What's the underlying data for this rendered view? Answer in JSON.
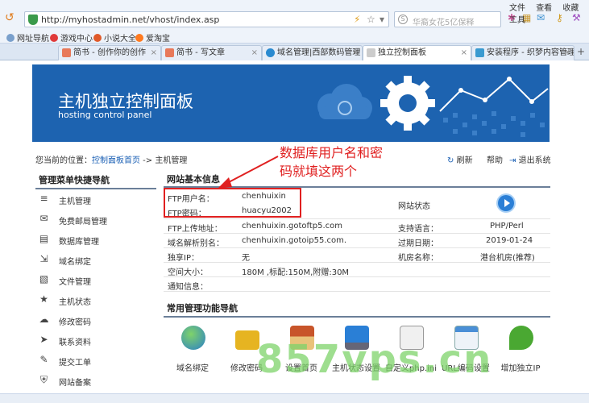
{
  "browser": {
    "url": "http://myhostadmin.net/vhost/index.asp",
    "search_placeholder": "华裔女花5亿保释",
    "menu": [
      "文件",
      "查看",
      "收藏",
      "工具"
    ],
    "bookmarks": [
      "网址导航",
      "游戏中心",
      "小说大全",
      "爱淘宝"
    ],
    "tabs": [
      {
        "label": "简书 - 创作你的创作",
        "active": false
      },
      {
        "label": "简书 - 写文章",
        "active": false
      },
      {
        "label": "域名管理|西部数码管理",
        "active": false
      },
      {
        "label": "独立控制面板",
        "active": true
      },
      {
        "label": "安装程序 - 织梦内容管理",
        "active": false
      }
    ],
    "new_tab": "+"
  },
  "banner": {
    "title": "主机独立控制面板",
    "subtitle": "hosting control panel"
  },
  "breadcrumb": {
    "prefix": "您当前的位置：",
    "home": "控制面板首页",
    "sep": " -> ",
    "current": "主机管理"
  },
  "actions": {
    "refresh": "刷新",
    "help": "帮助",
    "logout": "退出系统"
  },
  "sidebar": {
    "title": "管理菜单快捷导航",
    "items": [
      {
        "label": "主机管理",
        "icon": "database-icon"
      },
      {
        "label": "免费邮局管理",
        "icon": "mail-icon"
      },
      {
        "label": "数据库管理",
        "icon": "db-icon"
      },
      {
        "label": "域名绑定",
        "icon": "bind-icon"
      },
      {
        "label": "文件管理",
        "icon": "file-icon"
      },
      {
        "label": "主机状态",
        "icon": "star-icon"
      },
      {
        "label": "修改密码",
        "icon": "cloud-icon"
      },
      {
        "label": "联系资料",
        "icon": "send-icon"
      },
      {
        "label": "提交工单",
        "icon": "pencil-icon"
      },
      {
        "label": "网站备案",
        "icon": "shield-icon"
      }
    ]
  },
  "info": {
    "title": "网站基本信息",
    "ftp_user_label": "FTP用户名：",
    "ftp_user": "chenhuixin",
    "ftp_pass_label": "FTP密码：",
    "ftp_pass": "huacyu2002",
    "site_status_label": "网站状态",
    "ftp_addr_label": "FTP上传地址：",
    "ftp_addr": "chenhuixin.gotoftp5.com",
    "lang_label": "支持语言：",
    "lang": "PHP/Perl",
    "alias_label": "域名解析别名：",
    "alias": "chenhuixin.gotoip55.com.",
    "expire_label": "过期日期：",
    "expire": "2019-01-24",
    "ip_label": "独享IP：",
    "ip": "无",
    "room_label": "机房名称：",
    "room": "港台机房(推荐)",
    "space_label": "空间大小：",
    "space": "180M ,标配:150M,附赠:30M",
    "notice_label": "通知信息："
  },
  "annotation": {
    "line1": "数据库用户名和密",
    "line2": "码就填这两个"
  },
  "tools": {
    "title": "常用管理功能导航",
    "items": [
      {
        "label": "域名绑定",
        "icon": "globe-icon"
      },
      {
        "label": "修改密码",
        "icon": "lock-icon"
      },
      {
        "label": "设置首页",
        "icon": "home-icon"
      },
      {
        "label": "主机状态设置",
        "icon": "monitor-icon"
      },
      {
        "label": "自定义php.ini",
        "icon": "ini-icon"
      },
      {
        "label": "URL编码设置",
        "icon": "window-icon"
      },
      {
        "label": "增加独立IP",
        "icon": "ip-icon"
      }
    ]
  },
  "watermark": "857vps.cn",
  "colors": {
    "banner": "#1d63b0",
    "annotation": "#e02020",
    "link": "#1a5fb4"
  }
}
